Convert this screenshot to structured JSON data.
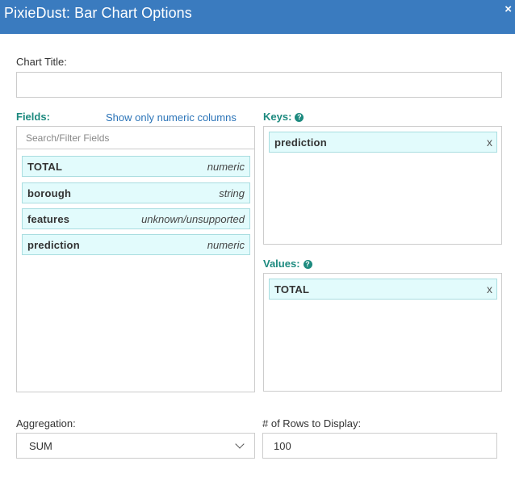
{
  "dialog": {
    "title": "PixieDust: Bar Chart Options",
    "close_label": "×"
  },
  "chart_title": {
    "label": "Chart Title:",
    "value": ""
  },
  "fields": {
    "label": "Fields:",
    "numeric_toggle_label": "Show only numeric columns",
    "search_placeholder": "Search/Filter Fields",
    "items": [
      {
        "name": "TOTAL",
        "type": "numeric"
      },
      {
        "name": "borough",
        "type": "string"
      },
      {
        "name": "features",
        "type": "unknown/unsupported"
      },
      {
        "name": "prediction",
        "type": "numeric"
      }
    ]
  },
  "keys": {
    "label": "Keys:",
    "help_icon": "?",
    "items": [
      {
        "name": "prediction",
        "remove_label": "x"
      }
    ]
  },
  "values": {
    "label": "Values:",
    "help_icon": "?",
    "items": [
      {
        "name": "TOTAL",
        "remove_label": "x"
      }
    ]
  },
  "aggregation": {
    "label": "Aggregation:",
    "selected": "SUM"
  },
  "rows": {
    "label": "# of Rows to Display:",
    "value": "100"
  },
  "colors": {
    "header_bg": "#3a7bbf",
    "accent": "#1d8a7f",
    "link": "#2b74b8",
    "item_bg": "#e2fbfc"
  }
}
